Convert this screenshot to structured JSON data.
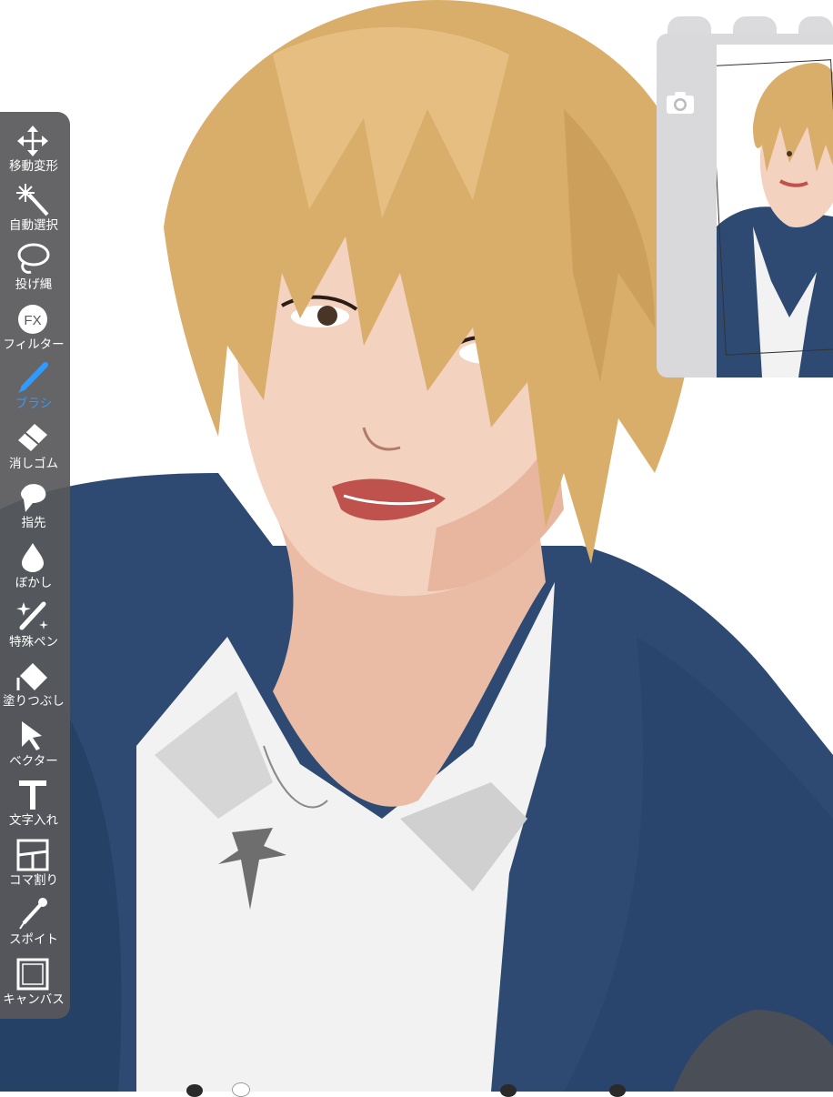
{
  "tools": [
    {
      "id": "move",
      "label": "移動変形",
      "icon": "move-icon",
      "active": false
    },
    {
      "id": "magic",
      "label": "自動選択",
      "icon": "magic-wand-icon",
      "active": false
    },
    {
      "id": "lasso",
      "label": "投げ縄",
      "icon": "lasso-icon",
      "active": false
    },
    {
      "id": "filter",
      "label": "フィルター",
      "icon": "fx-icon",
      "active": false
    },
    {
      "id": "brush",
      "label": "ブラシ",
      "icon": "brush-icon",
      "active": true
    },
    {
      "id": "eraser",
      "label": "消しゴム",
      "icon": "eraser-icon",
      "active": false
    },
    {
      "id": "smudge",
      "label": "指先",
      "icon": "smudge-icon",
      "active": false
    },
    {
      "id": "blur",
      "label": "ぼかし",
      "icon": "blur-drop-icon",
      "active": false
    },
    {
      "id": "special",
      "label": "特殊ペン",
      "icon": "special-pen-icon",
      "active": false
    },
    {
      "id": "fill",
      "label": "塗りつぶし",
      "icon": "fill-icon",
      "active": false
    },
    {
      "id": "vector",
      "label": "ベクター",
      "icon": "vector-arrow-icon",
      "active": false
    },
    {
      "id": "text",
      "label": "文字入れ",
      "icon": "text-icon",
      "active": false
    },
    {
      "id": "frame",
      "label": "コマ割り",
      "icon": "frame-divider-icon",
      "active": false
    },
    {
      "id": "eyedropper",
      "label": "スポイト",
      "icon": "eyedropper-icon",
      "active": false
    },
    {
      "id": "canvas",
      "label": "キャンバス",
      "icon": "canvas-icon",
      "active": false
    }
  ],
  "navigator": {
    "camera_icon": "camera-icon"
  },
  "colors": {
    "toolbar_bg": "#58585a",
    "active": "#2f9bff",
    "hair": "#d9ae6a",
    "jacket": "#2e4a72",
    "skin": "#f4d2c0"
  }
}
